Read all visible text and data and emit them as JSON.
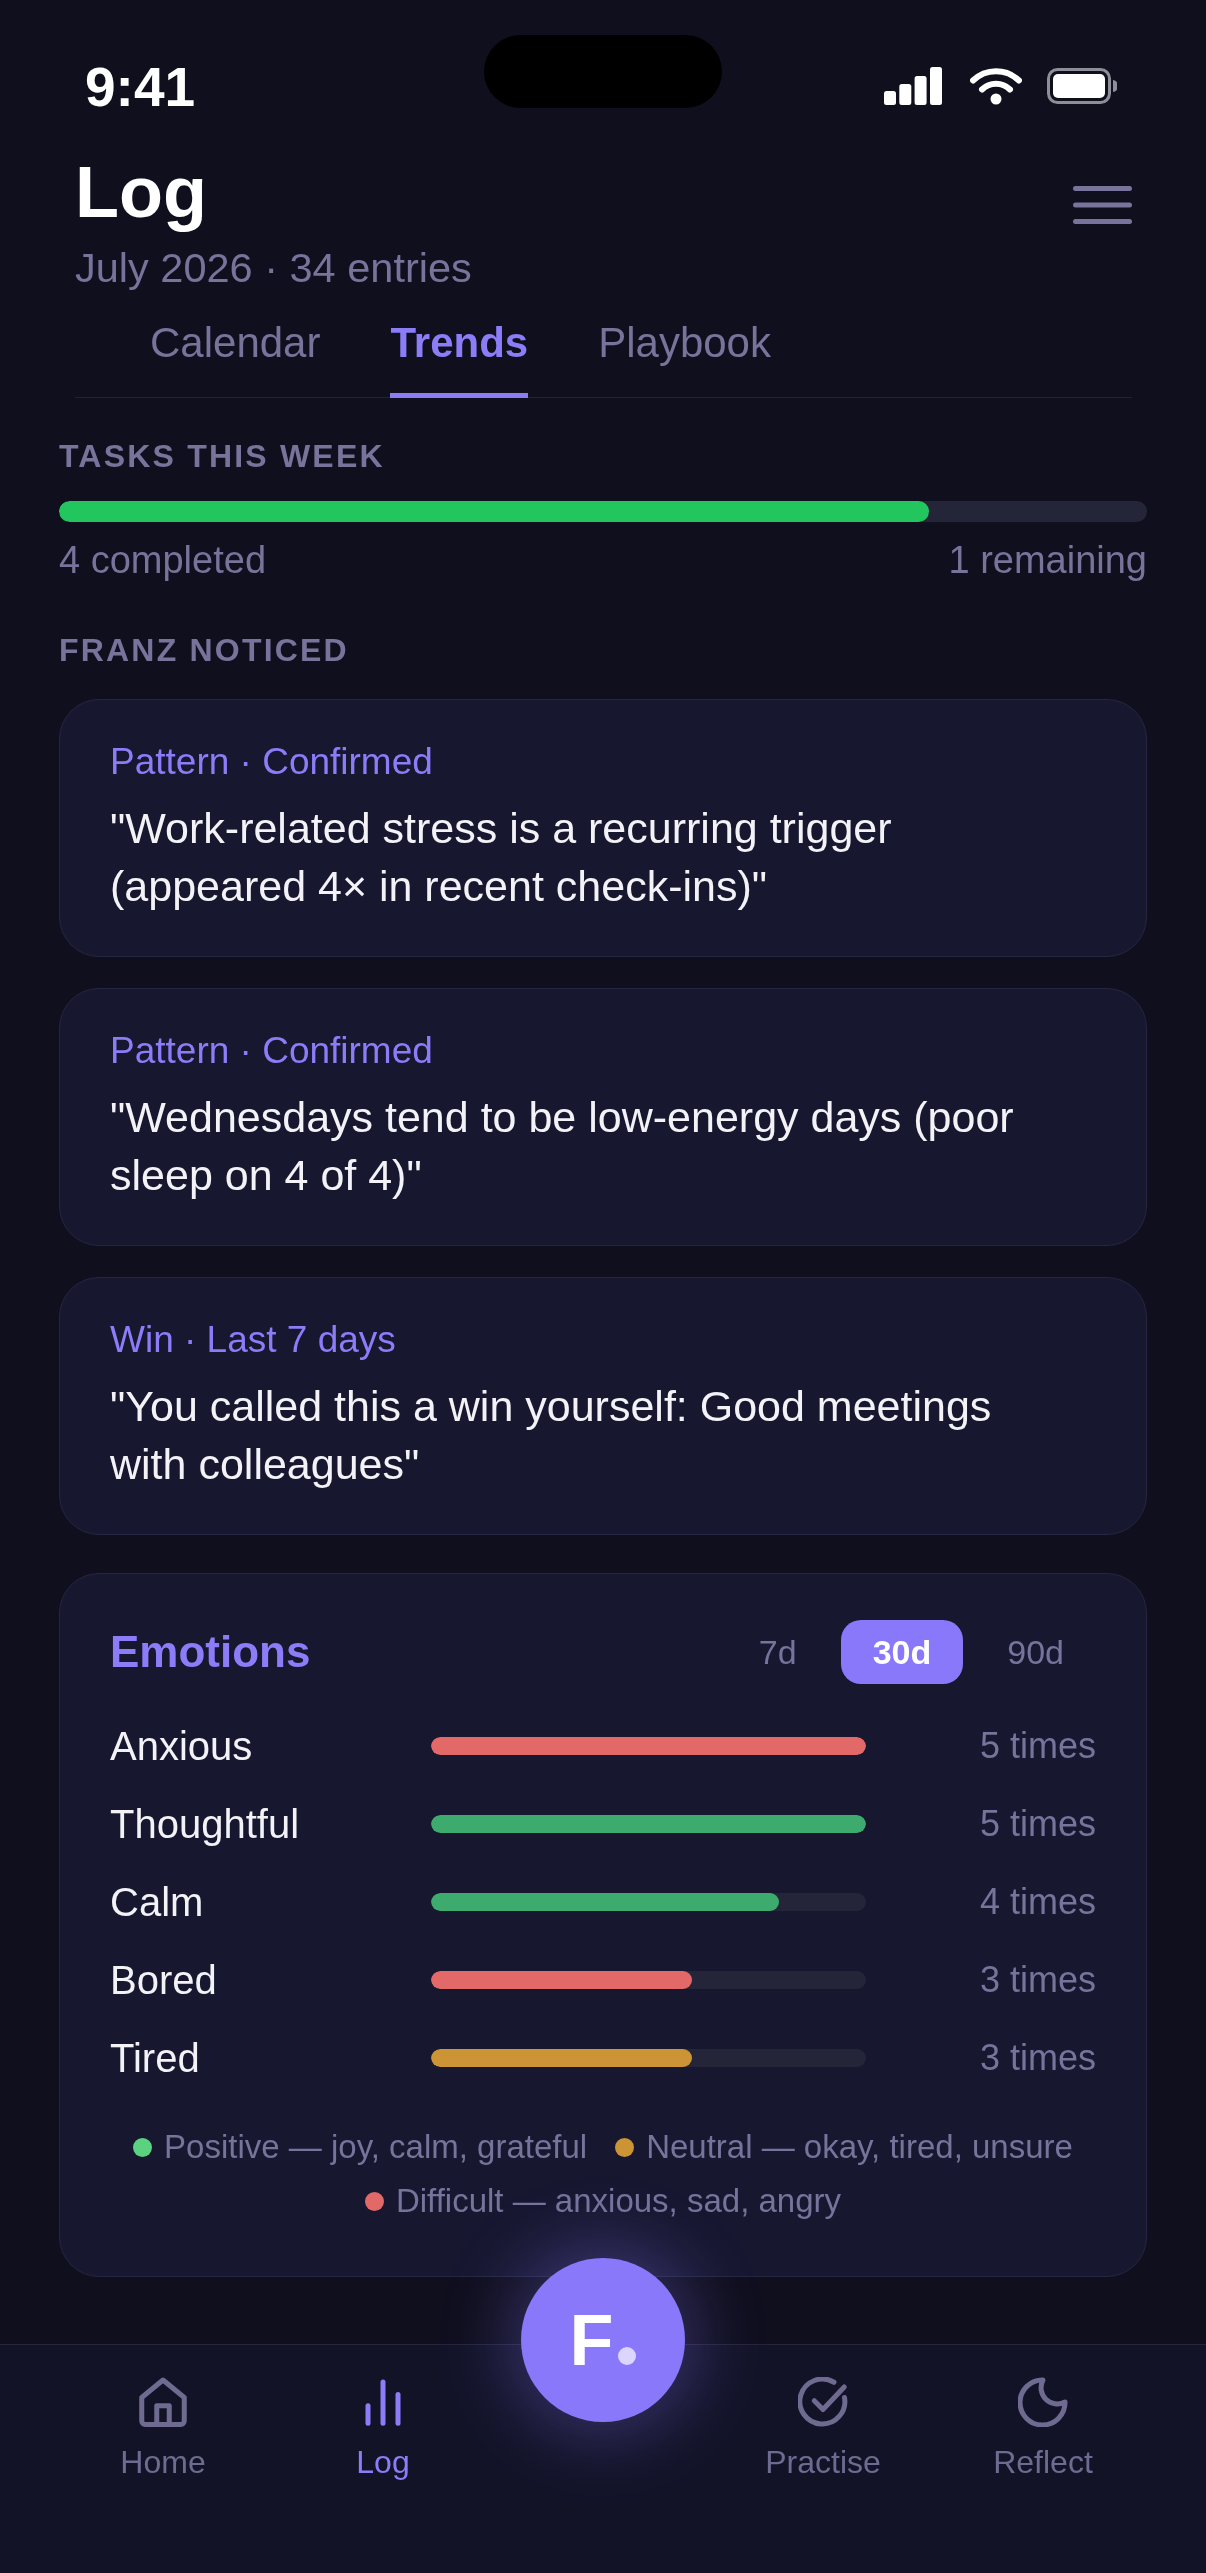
{
  "status_bar": {
    "time": "9:41"
  },
  "header": {
    "title": "Log",
    "subtitle": "July 2026 · 34 entries"
  },
  "tabs": [
    {
      "label": "Calendar",
      "selected": false
    },
    {
      "label": "Trends",
      "selected": true
    },
    {
      "label": "Playbook",
      "selected": false
    }
  ],
  "tasks": {
    "title": "TASKS THIS WEEK",
    "level": 0.8,
    "completed": "4 completed",
    "remaining": "1 remaining"
  },
  "insights": {
    "title": "FRANZ NOTICED",
    "items": [
      {
        "meta": "Pattern · Confirmed",
        "text": "\"Work-related stress is a recurring trigger (appeared 4× in recent check-ins)\""
      },
      {
        "meta": "Pattern · Confirmed",
        "text": "\"Wednesdays tend to be low-energy days (poor sleep on 4 of 4)\""
      },
      {
        "meta": "Win · Last 7 days",
        "text": "\"You called this a win yourself: Good meetings with colleagues\""
      }
    ]
  },
  "emotions": {
    "title": "Emotions",
    "ranges": [
      {
        "label": "7d",
        "selected": false
      },
      {
        "label": "30d",
        "selected": true
      },
      {
        "label": "90d",
        "selected": false
      }
    ],
    "rows": [
      {
        "name": "Anxious",
        "level": 1,
        "count": "5 times",
        "color": "#e36868"
      },
      {
        "name": "Thoughtful",
        "level": 1,
        "count": "5 times",
        "color": "#3daa6e"
      },
      {
        "name": "Calm",
        "level": 0.8,
        "count": "4 times",
        "color": "#3daa6e"
      },
      {
        "name": "Bored",
        "level": 0.6,
        "count": "3 times",
        "color": "#e36868"
      },
      {
        "name": "Tired",
        "level": 0.6,
        "count": "3 times",
        "color": "#cc9434"
      }
    ],
    "legend": [
      {
        "label": "Positive — joy, calm, grateful",
        "color": "#5ad27f"
      },
      {
        "label": "Neutral — okay, tired, unsure",
        "color": "#cc9434"
      },
      {
        "label": "Difficult — anxious, sad, angry",
        "color": "#e36868"
      }
    ]
  },
  "fab": {
    "label": "F"
  },
  "nav": [
    {
      "label": "Home",
      "selected": false
    },
    {
      "label": "Log",
      "selected": true
    },
    {
      "label": "Practise",
      "selected": false
    },
    {
      "label": "Reflect",
      "selected": false
    }
  ]
}
